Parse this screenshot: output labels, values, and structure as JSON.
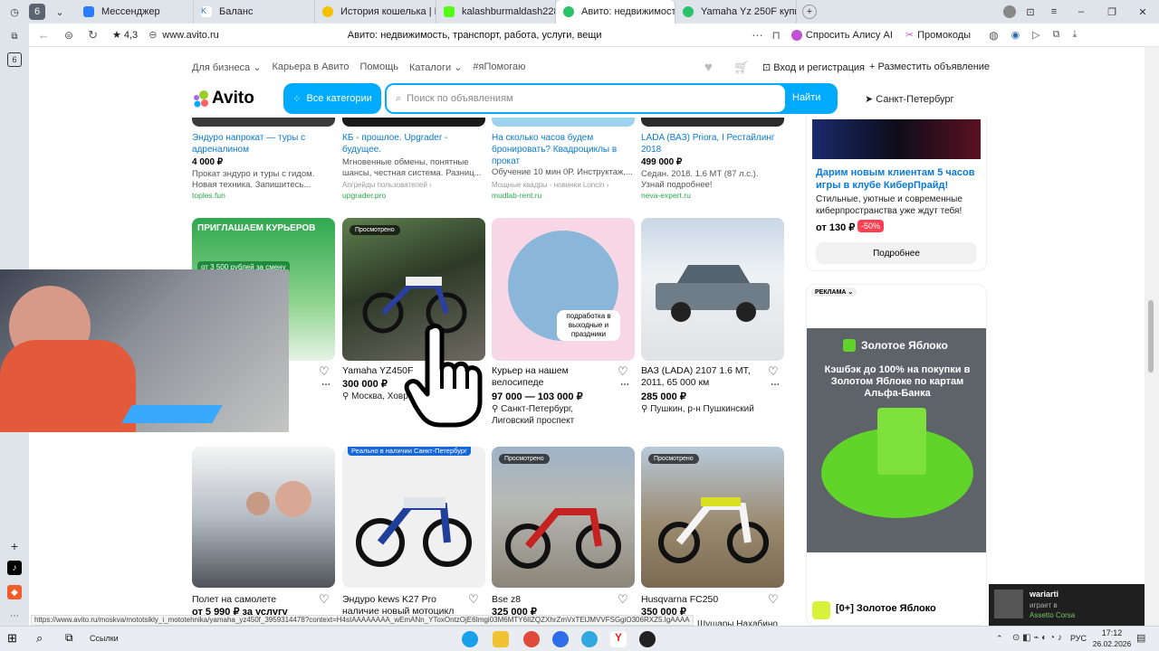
{
  "browser": {
    "tabs": [
      {
        "label": "Мессенджер"
      },
      {
        "label": "Баланс"
      },
      {
        "label": "История кошелька | Drag"
      },
      {
        "label": "kalashburmaldash228 Str"
      },
      {
        "label": "Авито: недвижимость"
      },
      {
        "label": "Yamaha Yz 250F купить в"
      }
    ],
    "tab_count": "6",
    "rating": "★ 4,3",
    "url": "www.avito.ru",
    "page_title": "Авито: недвижимость, транспорт, работа, услуги, вещи",
    "alice_label": "Спросить Алису AI",
    "promo_label": "Промокоды",
    "status_url": "https://www.avito.ru/moskva/mototsikly_i_mototehnika/yamaha_yz450f_3959314478?context=H4sIAAAAAAAA_wEmANn_YToxOntzOjE6Imgi03M6MTY6IlZQZXhrZmVxTElJMVVFSGgiO306RXZ5.IgAAAA"
  },
  "header": {
    "links": [
      "Для бизнеса ⌄",
      "Карьера в Авито",
      "Помощь",
      "Каталоги ⌄",
      "#яПомогаю"
    ],
    "login": "Вход и регистрация",
    "post": "Разместить объявление",
    "logo": "Avito",
    "categories": "Все категории",
    "search_placeholder": "Поиск по объявлениям",
    "search_button": "Найти",
    "city": "Санкт-Петербург"
  },
  "ads_row": [
    {
      "title": "Эндуро напрокат — туры с адреналином",
      "price": "4 000 ₽",
      "desc": "Прокат эндуро и туры с гидом. Новая техника. Запишитесь...",
      "source": "",
      "site": "toples.fun"
    },
    {
      "title": "КБ - прошлое. Upgrader - будущее.",
      "price": "",
      "desc": "Мгновенные обмены, понятные шансы, честная система. Разниц...",
      "source": "Апгрейды пользователей ›",
      "site": "upgrader.pro"
    },
    {
      "title": "На сколько часов будем бронировать? Квадроциклы в прокат",
      "price": "",
      "desc": "Обучение 10 мин 0Р. Инструктаж,...",
      "source": "Мощные квадры - новинки Loncin ›",
      "site": "mudlab-rent.ru"
    },
    {
      "title": "LADA (ВАЗ) Priora, I Рестайлинг 2018",
      "price": "499 000 ₽",
      "desc": "Седан. 2018. 1.6 MT (87 л.с.). Узнай подробнее!",
      "source": "",
      "site": "neva-expert.ru"
    }
  ],
  "items_row1": [
    {
      "title": "",
      "price": "",
      "loc": "",
      "badge": "",
      "img_text": "ПРИГЛАШАЕМ КУРЬЕРОВ",
      "img_text2": "от 3 500 рублей за смену"
    },
    {
      "title": "Yamaha YZ450F",
      "price": "300 000 ₽",
      "loc": "⚲ Москва, Ховр",
      "badge": "Просмотрено"
    },
    {
      "title": "Курьер на нашем велосипеде",
      "price": "97 000 — 103 000 ₽",
      "loc": "⚲ Санкт-Петербург, Лиговский проспект",
      "badge": "",
      "img_text": "подработка в выходные и праздники"
    },
    {
      "title": "ВАЗ (LADA) 2107 1.6 MT, 2011, 65 000 км",
      "price": "285 000 ₽",
      "loc": "⚲ Пушкин, р-н Пушкинский",
      "badge": ""
    }
  ],
  "items_row2": [
    {
      "title": "Полет на самолете",
      "price": "от 5 990 ₽ за услугу",
      "badge": ""
    },
    {
      "title": "Эндуро kews K27 Pro",
      "price": "наличие новый мотоцикл",
      "badge": "Реально в наличии Санкт-Петербург"
    },
    {
      "title": "Bse z8",
      "price": "325 000 ₽",
      "badge": "Просмотрено"
    },
    {
      "title": "Husqvarna FC250",
      "price": "350 000 ₽",
      "badge": "Просмотрено",
      "extra": "Шушары Нахабино"
    }
  ],
  "sidebar": {
    "promo_title": "Дарим новым клиентам 5 часов игры в клубе КиберПрайд!",
    "promo_desc": "Стильные, уютные и современные киберпространства уже ждут тебя!",
    "promo_price": "от 130 ₽",
    "promo_discount": "-50%",
    "promo_button": "Подробнее",
    "ad_label": "РЕКЛАМА ⌄",
    "ad_brand": "Золотое Яблоко",
    "ad_text": "Кэшбэк до 100% на покупки в Золотом Яблоке по картам Альфа-Банка",
    "ad_bottom": "[0+] Золотое Яблоко"
  },
  "stream": {
    "name": "wariarti",
    "status": "играет в",
    "game": "Assetto Corsa"
  },
  "taskbar": {
    "search": "Ссылки",
    "lang": "РУС",
    "time": "17:12",
    "date": "26.02.2026"
  }
}
